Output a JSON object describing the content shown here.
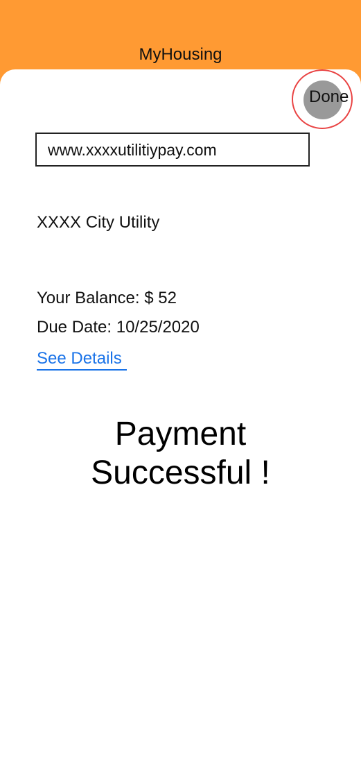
{
  "app": {
    "title": "MyHousing"
  },
  "toolbar": {
    "done_label": "Done"
  },
  "browser": {
    "url": "www.xxxxutilitiypay.com"
  },
  "bill": {
    "utility_name": "XXXX City Utility",
    "balance_text": "Your Balance: $ 52",
    "due_date_text": "Due Date: 10/25/2020",
    "details_link": "See Details"
  },
  "status": {
    "line1": "Payment",
    "line2": "Successful !"
  },
  "colors": {
    "header": "#ff9a33",
    "done_ring": "#e94343",
    "done_button": "#999999",
    "link": "#1a73e8"
  }
}
